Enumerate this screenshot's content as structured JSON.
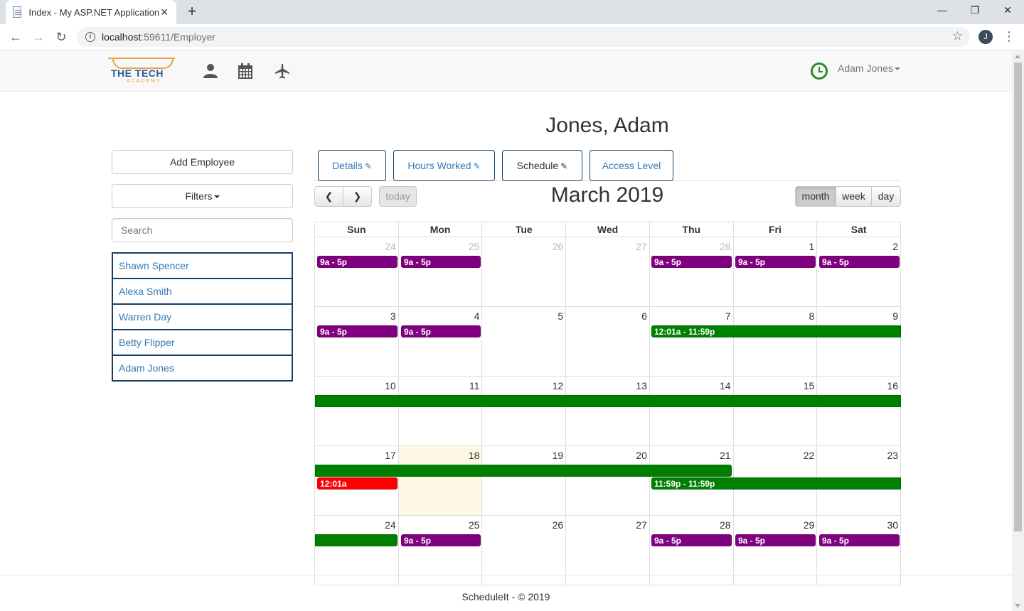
{
  "browser": {
    "tab_title": "Index - My ASP.NET Application",
    "url_host": "localhost",
    "url_rest": ":59611/Employer",
    "profile_initial": "J"
  },
  "nav": {
    "logo_text": "THE TECH",
    "logo_sub": "ACADEMY",
    "icons": [
      "user-icon",
      "calendar-icon",
      "plane-icon",
      "clock-icon"
    ],
    "user_name": "Adam Jones"
  },
  "employee_heading": "Jones, Adam",
  "sidebar": {
    "add_employee": "Add Employee",
    "filters": "Filters",
    "search_placeholder": "Search",
    "employees": [
      "Shawn Spencer",
      "Alexa Smith",
      "Warren Day",
      "Betty Flipper",
      "Adam Jones"
    ]
  },
  "tabs": [
    {
      "label": "Details",
      "icon": "edit-icon"
    },
    {
      "label": "Hours Worked",
      "icon": "edit-icon"
    },
    {
      "label": "Schedule",
      "icon": "edit-icon",
      "active": true
    },
    {
      "label": "Access Level"
    }
  ],
  "calendar": {
    "title": "March 2019",
    "today_label": "today",
    "views": [
      "month",
      "week",
      "day"
    ],
    "active_view": "month",
    "dow": [
      "Sun",
      "Mon",
      "Tue",
      "Wed",
      "Thu",
      "Fri",
      "Sat"
    ],
    "weeks": [
      [
        "24",
        "25",
        "26",
        "27",
        "28",
        "1",
        "2"
      ],
      [
        "3",
        "4",
        "5",
        "6",
        "7",
        "8",
        "9"
      ],
      [
        "10",
        "11",
        "12",
        "13",
        "14",
        "15",
        "16"
      ],
      [
        "17",
        "18",
        "19",
        "20",
        "21",
        "22",
        "23"
      ],
      [
        "24",
        "25",
        "26",
        "27",
        "28",
        "29",
        "30"
      ]
    ],
    "event_labels": {
      "shift": "9a - 5p",
      "all_day": "12:01a - 11:59p",
      "start": "12:01a",
      "late": "11:59p - 11:59p"
    },
    "colors": {
      "shift": "#800080",
      "leave": "#008000",
      "alert": "#ff0000",
      "today_bg": "#fcf8e3"
    }
  },
  "footer": "ScheduleIt - © 2019"
}
